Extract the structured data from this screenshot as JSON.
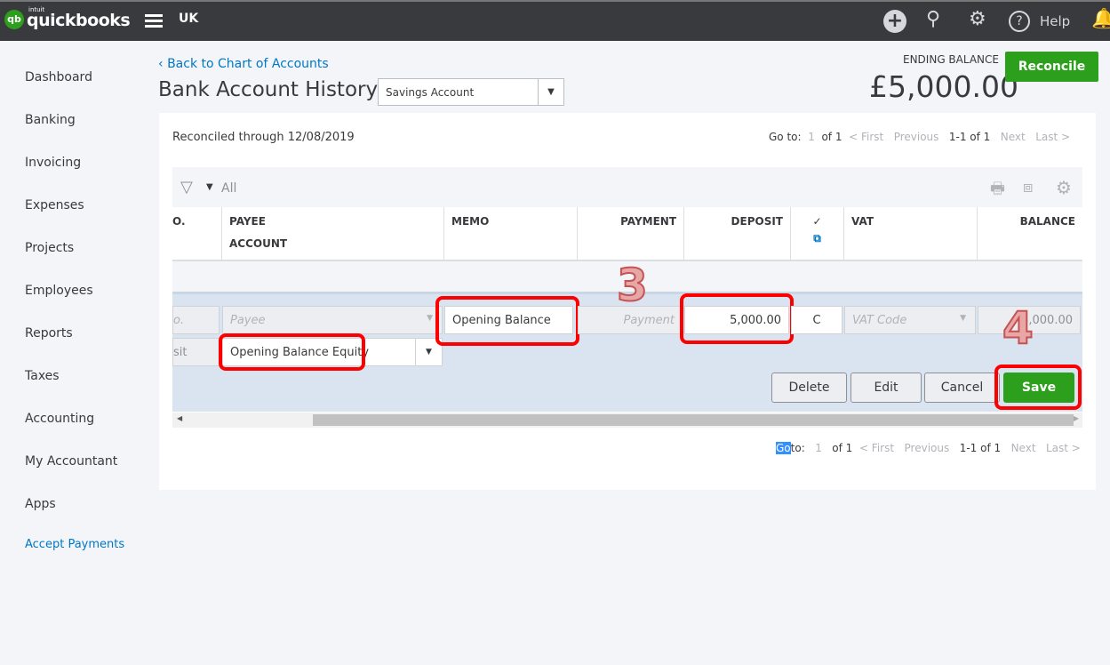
{
  "topbar": {
    "logo_small": "intuit",
    "logo": "quickbooks",
    "logo_mark": "qb",
    "region": "UK",
    "help": "Help",
    "icons": [
      "plus-icon",
      "search-icon",
      "gear-icon",
      "help-icon",
      "bell-icon"
    ]
  },
  "sidebar": {
    "items": [
      "Dashboard",
      "Banking",
      "Invoicing",
      "Expenses",
      "Projects",
      "Employees",
      "Reports",
      "Taxes",
      "Accounting",
      "My Accountant",
      "Apps",
      "Accept Payments"
    ]
  },
  "header": {
    "back": "Back to Chart of Accounts",
    "title": "Bank Account History",
    "account": "Savings Account",
    "ending_label": "ENDING BALANCE",
    "ending_value": "£5,000.00",
    "reconcile": "Reconcile"
  },
  "panel": {
    "reconciled": "Reconciled through 12/08/2019",
    "pagination": {
      "goto": "Go to:",
      "page": "1",
      "of": "of 1",
      "first": "< First",
      "previous": "Previous",
      "range": "1-1 of 1",
      "next": "Next",
      "last": "Last >"
    },
    "bottom_pagination": {
      "go_sel": "Go",
      "to": "to:",
      "page": "1",
      "of": "of 1",
      "first": "< First",
      "previous": "Previous",
      "range": "1-1 of 1",
      "next": "Next",
      "last": "Last >"
    },
    "filter": "All",
    "columns": {
      "no": "O.",
      "payee": "PAYEE",
      "account": "ACCOUNT",
      "memo": "MEMO",
      "payment": "PAYMENT",
      "deposit": "DEPOSIT",
      "check": "✓",
      "vat": "VAT",
      "balance": "BALANCE"
    },
    "edit": {
      "no_ph": "o.",
      "payee_ph": "Payee",
      "type": "sit",
      "account": "Opening Balance Equity",
      "memo": "Opening Balance",
      "payment_ph": "Payment",
      "deposit": "5,000.00",
      "cleared": "C",
      "vat_ph": "VAT Code",
      "balance": "5,000.00"
    },
    "buttons": {
      "delete": "Delete",
      "edit": "Edit",
      "cancel": "Cancel",
      "save": "Save"
    },
    "annotations": {
      "step3": "3",
      "step4": "4"
    }
  }
}
